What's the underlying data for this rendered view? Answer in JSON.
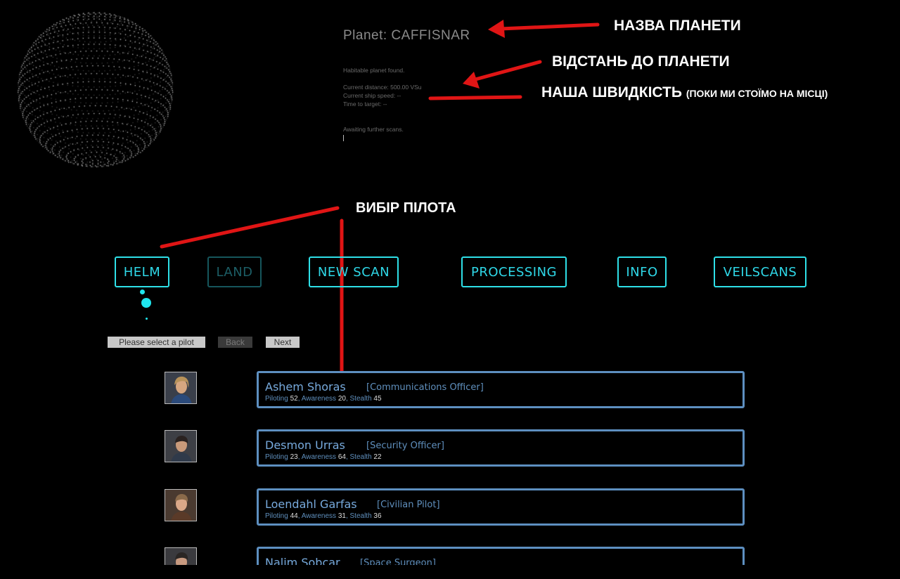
{
  "planet": {
    "title": "Planet: CAFFISNAR",
    "status": "Habitable planet found.",
    "distance": "Current distance: 500.00 VSu",
    "speed": "Current ship speed: --",
    "time": "Time to target: --",
    "awaiting": "Awaiting further scans."
  },
  "annotations": {
    "planet_name": "НАЗВА ПЛАНЕТИ",
    "planet_distance": "ВІДСТАНЬ ДО ПЛАНЕТИ",
    "speed": "НАША ШВИДКІСТЬ",
    "speed_note": "(ПОКИ МИ СТОЇМО НА МІСЦІ)",
    "pilot_select": "ВИБІР ПІЛОТА"
  },
  "nav": {
    "helm": "HELM",
    "land": "LAND",
    "new_scan": "NEW SCAN",
    "processing": "PROCESSING",
    "info": "INFO",
    "veilscans": "VEILSCANS"
  },
  "controls": {
    "status": "Please select a pilot",
    "back": "Back",
    "next": "Next"
  },
  "pilot_labels": {
    "piloting": "Piloting",
    "awareness": "Awareness",
    "stealth": "Stealth"
  },
  "pilots": [
    {
      "name": "Ashem Shoras",
      "role": "[Communications Officer]",
      "piloting": "52",
      "awareness": "20",
      "stealth": "45"
    },
    {
      "name": "Desmon Urras",
      "role": "[Security Officer]",
      "piloting": "23",
      "awareness": "64",
      "stealth": "22"
    },
    {
      "name": "Loendahl Garfas",
      "role": "[Civilian Pilot]",
      "piloting": "44",
      "awareness": "31",
      "stealth": "36"
    },
    {
      "name": "Nalim Sobcar",
      "role": "[Space Surgeon]",
      "piloting": "",
      "awareness": "",
      "stealth": ""
    }
  ],
  "colors": {
    "accent": "#2ee0e8",
    "card_border": "#5d8fc0",
    "annotation_arrow": "#e01515"
  }
}
